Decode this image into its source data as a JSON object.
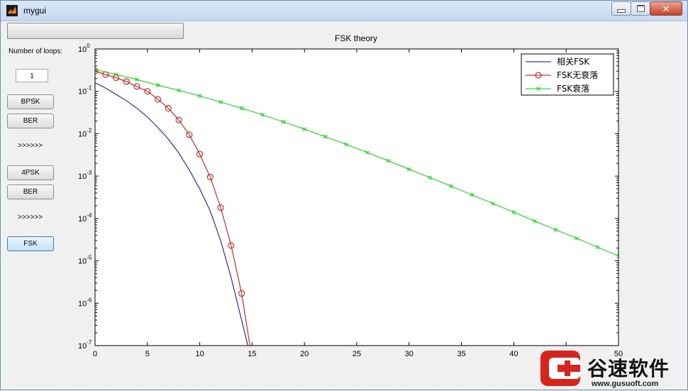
{
  "window": {
    "title": "mygui"
  },
  "progress": {
    "fraction": 0.0
  },
  "sidebar": {
    "loops_label": "Number of loops:",
    "loops_value": "1",
    "bpsk_label": "BPSK",
    "ber1_label": "BER",
    "arrows1": ">>>>>>",
    "qpsk_label": "4PSK",
    "ber2_label": "BER",
    "arrows2": ">>>>>>",
    "fsk_label": "FSK"
  },
  "watermark": {
    "name": "谷速软件",
    "url": "www.gusuoft.com"
  },
  "chart_data": {
    "type": "line",
    "title": "FSK theory",
    "xlabel": "",
    "ylabel": "",
    "xlim": [
      0,
      50
    ],
    "ylim": [
      1e-07,
      1
    ],
    "yscale": "log",
    "x_ticks": [
      "0",
      "5",
      "10",
      "15",
      "20",
      "25",
      "30",
      "35",
      "40",
      "45",
      "50"
    ],
    "y_ticks": [
      {
        "base": "10",
        "exp": "0"
      },
      {
        "base": "10",
        "exp": "-1"
      },
      {
        "base": "10",
        "exp": "-2"
      },
      {
        "base": "10",
        "exp": "-3"
      },
      {
        "base": "10",
        "exp": "-4"
      },
      {
        "base": "10",
        "exp": "-5"
      },
      {
        "base": "10",
        "exp": "-6"
      },
      {
        "base": "10",
        "exp": "-7"
      }
    ],
    "legend_position": "top-right",
    "series": [
      {
        "name": "相关FSK",
        "color": "#0000cc",
        "marker": "none",
        "x": [
          0,
          1,
          2,
          3,
          4,
          5,
          6,
          7,
          8,
          9,
          10,
          11,
          12,
          13,
          14,
          14.6
        ],
        "y": [
          0.16,
          0.12,
          0.085,
          0.06,
          0.04,
          0.025,
          0.014,
          0.0075,
          0.0035,
          0.0014,
          0.0005,
          0.00015,
          3e-05,
          4e-06,
          4e-07,
          1e-07
        ]
      },
      {
        "name": "FSK无衰落",
        "color": "#dd0000",
        "marker": "circle",
        "x": [
          0,
          1,
          2,
          3,
          4,
          5,
          6,
          7,
          8,
          9,
          10,
          11,
          12,
          13,
          14,
          14.8
        ],
        "y": [
          0.3,
          0.25,
          0.21,
          0.17,
          0.13,
          0.1,
          0.065,
          0.04,
          0.021,
          0.0095,
          0.0033,
          0.00095,
          0.00018,
          2.3e-05,
          1.7e-06,
          1e-07
        ]
      },
      {
        "name": "FSK衰落",
        "color": "#00dd00",
        "marker": "x",
        "x": [
          0,
          2,
          4,
          6,
          8,
          10,
          12,
          14,
          16,
          18,
          20,
          22,
          24,
          26,
          28,
          30,
          32,
          34,
          36,
          38,
          40,
          42,
          44,
          46,
          48,
          50
        ],
        "y": [
          0.33,
          0.25,
          0.19,
          0.14,
          0.105,
          0.078,
          0.056,
          0.04,
          0.028,
          0.019,
          0.0128,
          0.0085,
          0.0056,
          0.0036,
          0.0023,
          0.00145,
          0.00092,
          0.00058,
          0.00036,
          0.000225,
          0.00014,
          8.7e-05,
          5.4e-05,
          3.4e-05,
          2.1e-05,
          1.3e-05
        ]
      }
    ]
  }
}
